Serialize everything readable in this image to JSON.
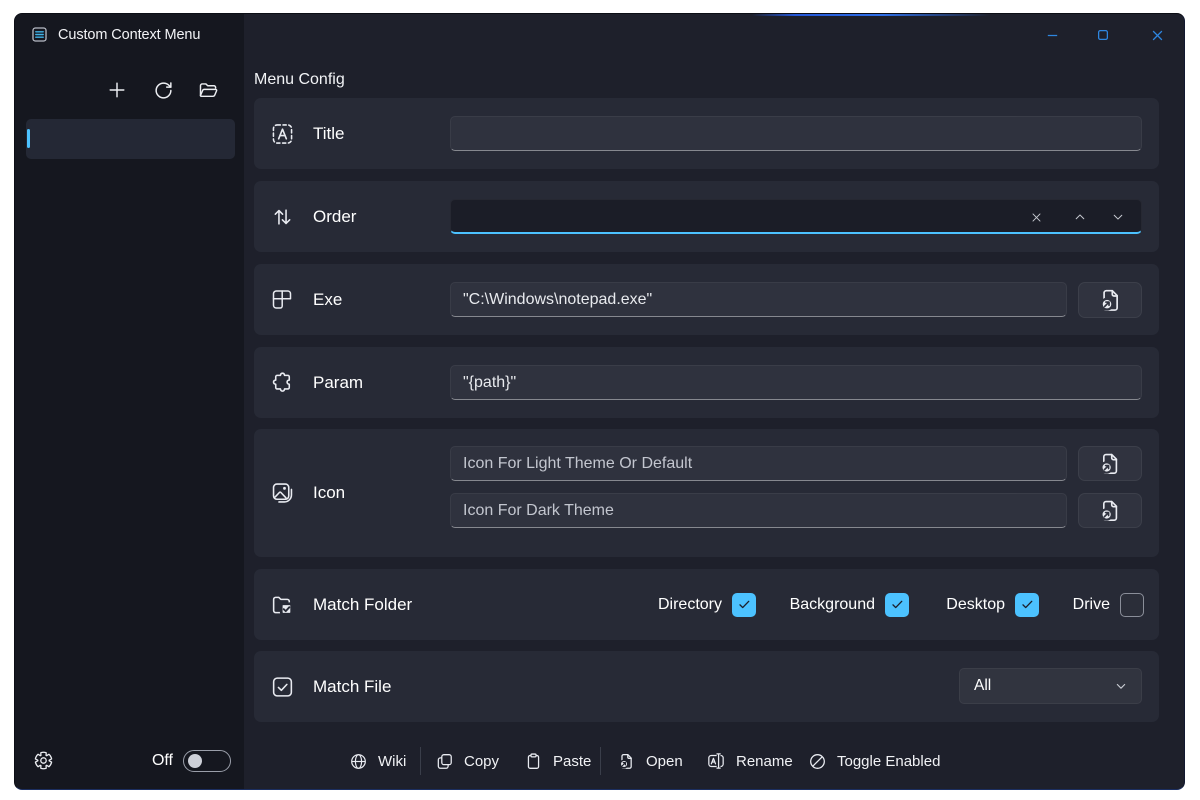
{
  "window": {
    "title": "Custom Context Menu",
    "controls": {
      "minimize": "minimize",
      "maximize": "maximize",
      "close": "close"
    }
  },
  "sidebar": {
    "toolbar": [
      {
        "name": "add"
      },
      {
        "name": "refresh"
      },
      {
        "name": "open-folder"
      }
    ],
    "items": [
      {
        "label": "",
        "selected": true
      }
    ],
    "footer": {
      "settings": "settings",
      "toggle_label": "Off",
      "toggle_on": false
    }
  },
  "main": {
    "heading": "Menu Config",
    "rows": [
      {
        "id": "title",
        "label": "Title",
        "input": {
          "value": "",
          "placeholder": ""
        }
      },
      {
        "id": "order",
        "label": "Order",
        "input": {
          "value": "",
          "placeholder": ""
        },
        "focused": true,
        "buttons": [
          "clear",
          "increment",
          "decrement"
        ]
      },
      {
        "id": "exe",
        "label": "Exe",
        "input": {
          "value": "\"C:\\Windows\\notepad.exe\"",
          "placeholder": ""
        },
        "browse": true
      },
      {
        "id": "param",
        "label": "Param",
        "input": {
          "value": "\"{path}\"",
          "placeholder": ""
        }
      },
      {
        "id": "icon",
        "label": "Icon",
        "inputs": [
          {
            "value": "",
            "placeholder": "Icon For Light Theme Or Default",
            "browse": true
          },
          {
            "value": "",
            "placeholder": "Icon For Dark Theme",
            "browse": true
          }
        ]
      },
      {
        "id": "match_folder",
        "label": "Match Folder",
        "checkboxes": [
          {
            "label": "Directory",
            "checked": true
          },
          {
            "label": "Background",
            "checked": true
          },
          {
            "label": "Desktop",
            "checked": true
          },
          {
            "label": "Drive",
            "checked": false
          }
        ]
      },
      {
        "id": "match_file",
        "label": "Match File",
        "dropdown": {
          "value": "All"
        }
      }
    ],
    "footer_buttons": [
      {
        "label": "Wiki"
      },
      {
        "label": "Copy"
      },
      {
        "label": "Paste"
      },
      {
        "label": "Open"
      },
      {
        "label": "Rename"
      },
      {
        "label": "Toggle Enabled"
      }
    ]
  },
  "colors": {
    "accent": "#4CC2FF",
    "window_controls": "#2E86E0",
    "titlebar_icon_lines": "#3FB3E8",
    "window_bg": "#1E202B",
    "sidebar_bg": "#15171F",
    "card_bg": "#272A36"
  }
}
